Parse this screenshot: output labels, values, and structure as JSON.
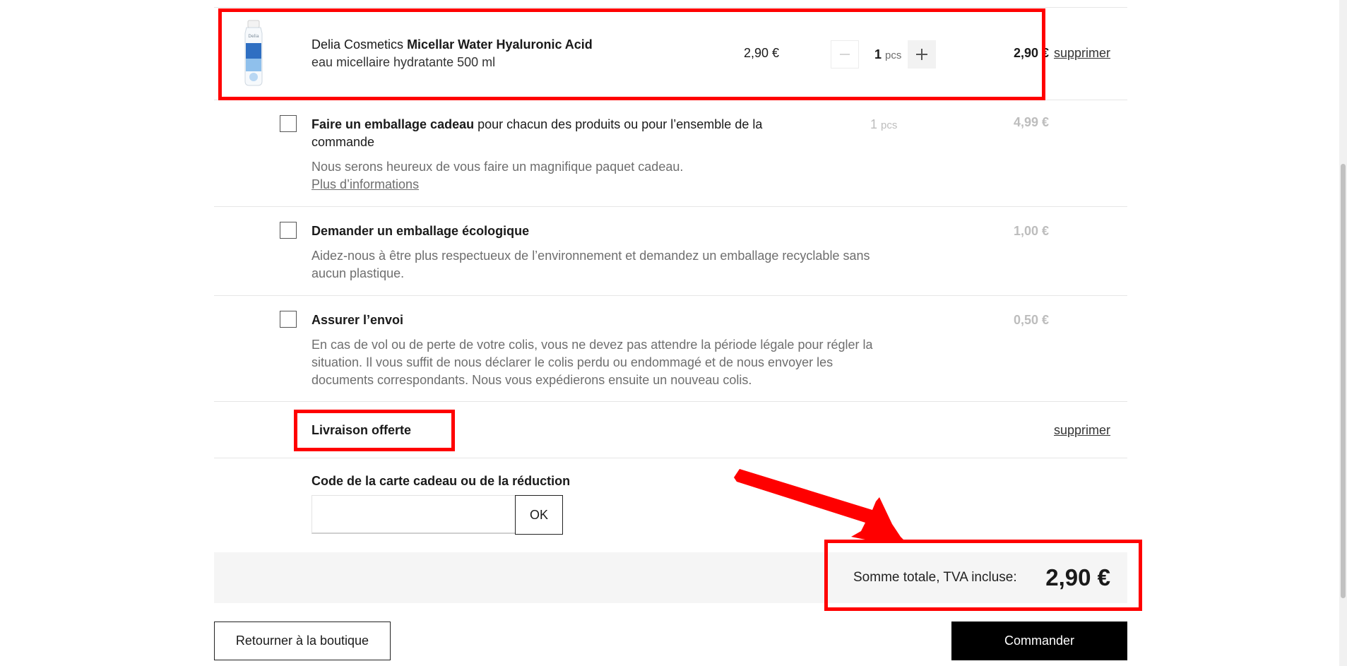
{
  "product": {
    "brand": "Delia Cosmetics",
    "name": "Micellar Water Hyaluronic Acid",
    "description": "eau micellaire hydratante 500 ml",
    "unit_price": "2,90 €",
    "quantity": "1",
    "quantity_unit": "pcs",
    "line_total": "2,90 €",
    "remove_label": "supprimer",
    "image_icon": "micellar-water-bottle-icon"
  },
  "options": [
    {
      "title_bold": "Faire un emballage cadeau",
      "title_rest": " pour chacun des produits ou pour l’ensemble de la commande",
      "description": "Nous serons heureux de vous faire un magnifique paquet cadeau.",
      "more_link": "Plus d’informations",
      "quantity": "1",
      "quantity_unit": "pcs",
      "price": "4,99 €",
      "checked": false
    },
    {
      "title_bold": "Demander un emballage écologique",
      "description": "Aidez-nous à être plus respectueux de l’environnement et demandez un emballage recyclable sans aucun plastique.",
      "price": "1,00 €",
      "checked": false
    },
    {
      "title_bold": "Assurer l’envoi",
      "description": "En cas de vol ou de perte de votre colis, vous ne devez pas attendre la période légale pour régler la situation. Il vous suffit de nous déclarer le colis perdu ou endommagé et de nous envoyer les documents correspondants. Nous vous expédierons ensuite un nouveau colis.",
      "price": "0,50 €",
      "checked": false
    }
  ],
  "shipping": {
    "label": "Livraison offerte",
    "remove_label": "supprimer"
  },
  "voucher": {
    "label": "Code de la carte cadeau ou de la réduction",
    "value": "",
    "ok_label": "OK"
  },
  "total": {
    "label": "Somme totale, TVA incluse:",
    "value": "2,90 €"
  },
  "actions": {
    "back_label": "Retourner à la boutique",
    "order_label": "Commander"
  },
  "colors": {
    "highlight": "#ff0000",
    "primary_button": "#000000",
    "total_bar": "#f5f5f5"
  }
}
